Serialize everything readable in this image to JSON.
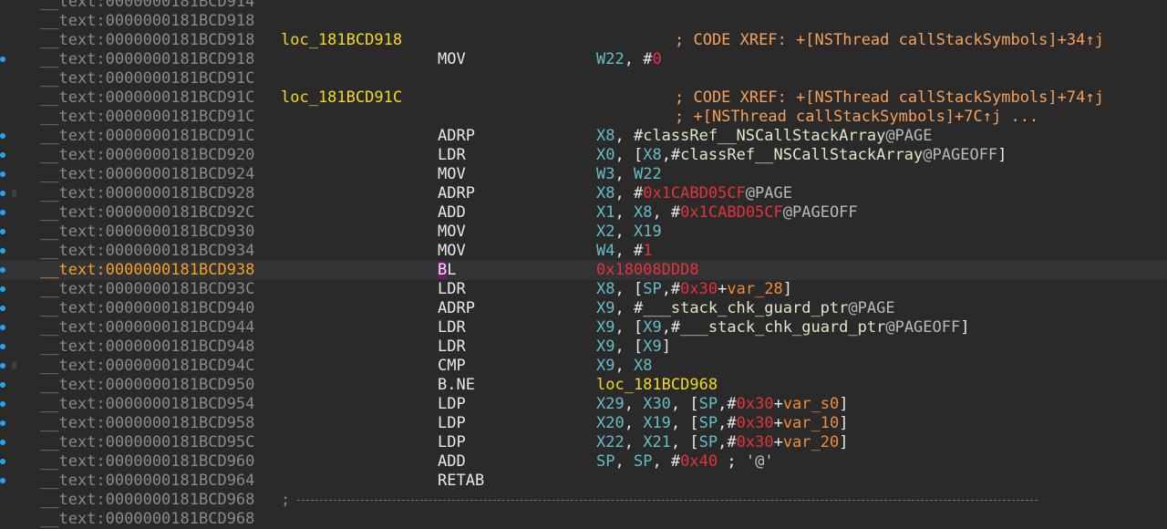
{
  "rows": [
    {
      "addr": "__text:0000000181BCD914",
      "label": "",
      "mnemonic": "",
      "operands": [],
      "comment": "",
      "gutter": "",
      "current": false,
      "separator": false
    },
    {
      "addr": "__text:0000000181BCD918",
      "label": "",
      "mnemonic": "",
      "operands": [],
      "comment": "",
      "gutter": "",
      "current": false,
      "separator": false
    },
    {
      "addr": "__text:0000000181BCD918",
      "label": "loc_181BCD918",
      "mnemonic": "",
      "operands": [],
      "comment": "; CODE XREF: +[NSThread callStackSymbols]+34↑j",
      "gutter": "",
      "current": false,
      "separator": false
    },
    {
      "addr": "__text:0000000181BCD918",
      "label": "",
      "mnemonic": "MOV",
      "operands": [
        [
          "W22",
          "reg"
        ],
        [
          ", #",
          "pun"
        ],
        [
          "0",
          "num"
        ]
      ],
      "comment": "",
      "gutter": "dot",
      "current": false,
      "separator": false
    },
    {
      "addr": "__text:0000000181BCD91C",
      "label": "",
      "mnemonic": "",
      "operands": [],
      "comment": "",
      "gutter": "",
      "current": false,
      "separator": false
    },
    {
      "addr": "__text:0000000181BCD91C",
      "label": "loc_181BCD91C",
      "mnemonic": "",
      "operands": [],
      "comment": "; CODE XREF: +[NSThread callStackSymbols]+74↑j",
      "gutter": "",
      "current": false,
      "separator": false
    },
    {
      "addr": "__text:0000000181BCD91C",
      "label": "",
      "mnemonic": "",
      "operands": [],
      "comment": "; +[NSThread callStackSymbols]+7C↑j ...",
      "gutter": "",
      "current": false,
      "separator": false
    },
    {
      "addr": "__text:0000000181BCD91C",
      "label": "",
      "mnemonic": "ADRP",
      "operands": [
        [
          "X8",
          "reg"
        ],
        [
          ", #",
          "pun"
        ],
        [
          "classRef__NSCallStackArray",
          "sym"
        ],
        [
          "@PAGE",
          "dim"
        ]
      ],
      "comment": "",
      "gutter": "dot",
      "current": false,
      "separator": false
    },
    {
      "addr": "__text:0000000181BCD920",
      "label": "",
      "mnemonic": "LDR",
      "operands": [
        [
          "X0",
          "reg"
        ],
        [
          ", [",
          "pun"
        ],
        [
          "X8",
          "reg"
        ],
        [
          ",#",
          "pun"
        ],
        [
          "classRef__NSCallStackArray",
          "sym"
        ],
        [
          "@PAGEOFF",
          "dim"
        ],
        [
          "]",
          "pun"
        ]
      ],
      "comment": "",
      "gutter": "dot",
      "current": false,
      "separator": false
    },
    {
      "addr": "__text:0000000181BCD924",
      "label": "",
      "mnemonic": "MOV",
      "operands": [
        [
          "W3",
          "reg"
        ],
        [
          ", ",
          "pun"
        ],
        [
          "W22",
          "reg"
        ]
      ],
      "comment": "",
      "gutter": "dot",
      "current": false,
      "separator": false
    },
    {
      "addr": "__text:0000000181BCD928",
      "label": "",
      "mnemonic": "ADRP",
      "operands": [
        [
          "X8",
          "reg"
        ],
        [
          ", #",
          "pun"
        ],
        [
          "0x1CABD05CF",
          "num"
        ],
        [
          "@PAGE",
          "dim"
        ]
      ],
      "comment": "",
      "gutter": "dot",
      "current": false,
      "separator": false
    },
    {
      "addr": "__text:0000000181BCD92C",
      "label": "",
      "mnemonic": "ADD",
      "operands": [
        [
          "X1",
          "reg"
        ],
        [
          ", ",
          "pun"
        ],
        [
          "X8",
          "reg"
        ],
        [
          ", #",
          "pun"
        ],
        [
          "0x1CABD05CF",
          "num"
        ],
        [
          "@PAGEOFF",
          "dim"
        ]
      ],
      "comment": "",
      "gutter": "dot",
      "current": false,
      "separator": false
    },
    {
      "addr": "__text:0000000181BCD930",
      "label": "",
      "mnemonic": "MOV",
      "operands": [
        [
          "X2",
          "reg"
        ],
        [
          ", ",
          "pun"
        ],
        [
          "X19",
          "reg"
        ]
      ],
      "comment": "",
      "gutter": "dot",
      "current": false,
      "separator": false
    },
    {
      "addr": "__text:0000000181BCD934",
      "label": "",
      "mnemonic": "MOV",
      "operands": [
        [
          "W4",
          "reg"
        ],
        [
          ", #",
          "pun"
        ],
        [
          "1",
          "num"
        ]
      ],
      "comment": "",
      "gutter": "dot",
      "current": false,
      "separator": false
    },
    {
      "addr": "__text:0000000181BCD938",
      "label": "",
      "mnemonic": "BL",
      "operands": [
        [
          "0x18008DDD8",
          "call"
        ]
      ],
      "comment": "",
      "gutter": "dot",
      "current": true,
      "separator": false
    },
    {
      "addr": "__text:0000000181BCD93C",
      "label": "",
      "mnemonic": "LDR",
      "operands": [
        [
          "X8",
          "reg"
        ],
        [
          ", [",
          "pun"
        ],
        [
          "SP",
          "reg"
        ],
        [
          ",#",
          "pun"
        ],
        [
          "0x30",
          "num"
        ],
        [
          "+",
          "pun"
        ],
        [
          "var_28",
          "off"
        ],
        [
          "]",
          "pun"
        ]
      ],
      "comment": "",
      "gutter": "dot",
      "current": false,
      "separator": false
    },
    {
      "addr": "__text:0000000181BCD940",
      "label": "",
      "mnemonic": "ADRP",
      "operands": [
        [
          "X9",
          "reg"
        ],
        [
          ", #",
          "pun"
        ],
        [
          "___stack_chk_guard_ptr",
          "sym"
        ],
        [
          "@PAGE",
          "dim"
        ]
      ],
      "comment": "",
      "gutter": "dot",
      "current": false,
      "separator": false
    },
    {
      "addr": "__text:0000000181BCD944",
      "label": "",
      "mnemonic": "LDR",
      "operands": [
        [
          "X9",
          "reg"
        ],
        [
          ", [",
          "pun"
        ],
        [
          "X9",
          "reg"
        ],
        [
          ",#",
          "pun"
        ],
        [
          "___stack_chk_guard_ptr",
          "sym"
        ],
        [
          "@PAGEOFF",
          "dim"
        ],
        [
          "]",
          "pun"
        ]
      ],
      "comment": "",
      "gutter": "dot",
      "current": false,
      "separator": false
    },
    {
      "addr": "__text:0000000181BCD948",
      "label": "",
      "mnemonic": "LDR",
      "operands": [
        [
          "X9",
          "reg"
        ],
        [
          ", [",
          "pun"
        ],
        [
          "X9",
          "reg"
        ],
        [
          "]",
          "pun"
        ]
      ],
      "comment": "",
      "gutter": "dot",
      "current": false,
      "separator": false
    },
    {
      "addr": "__text:0000000181BCD94C",
      "label": "",
      "mnemonic": "CMP",
      "operands": [
        [
          "X9",
          "reg"
        ],
        [
          ", ",
          "pun"
        ],
        [
          "X8",
          "reg"
        ]
      ],
      "comment": "",
      "gutter": "dot",
      "current": false,
      "separator": false
    },
    {
      "addr": "__text:0000000181BCD950",
      "label": "",
      "mnemonic": "B.NE",
      "operands": [
        [
          "loc_181BCD968",
          "loc"
        ]
      ],
      "comment": "",
      "gutter": "dot",
      "current": false,
      "separator": false
    },
    {
      "addr": "__text:0000000181BCD954",
      "label": "",
      "mnemonic": "LDP",
      "operands": [
        [
          "X29",
          "reg"
        ],
        [
          ", ",
          "pun"
        ],
        [
          "X30",
          "reg"
        ],
        [
          ", [",
          "pun"
        ],
        [
          "SP",
          "reg"
        ],
        [
          ",#",
          "pun"
        ],
        [
          "0x30",
          "num"
        ],
        [
          "+",
          "pun"
        ],
        [
          "var_s0",
          "off"
        ],
        [
          "]",
          "pun"
        ]
      ],
      "comment": "",
      "gutter": "dot",
      "current": false,
      "separator": false
    },
    {
      "addr": "__text:0000000181BCD958",
      "label": "",
      "mnemonic": "LDP",
      "operands": [
        [
          "X20",
          "reg"
        ],
        [
          ", ",
          "pun"
        ],
        [
          "X19",
          "reg"
        ],
        [
          ", [",
          "pun"
        ],
        [
          "SP",
          "reg"
        ],
        [
          ",#",
          "pun"
        ],
        [
          "0x30",
          "num"
        ],
        [
          "+",
          "pun"
        ],
        [
          "var_10",
          "off"
        ],
        [
          "]",
          "pun"
        ]
      ],
      "comment": "",
      "gutter": "dot",
      "current": false,
      "separator": false
    },
    {
      "addr": "__text:0000000181BCD95C",
      "label": "",
      "mnemonic": "LDP",
      "operands": [
        [
          "X22",
          "reg"
        ],
        [
          ", ",
          "pun"
        ],
        [
          "X21",
          "reg"
        ],
        [
          ", [",
          "pun"
        ],
        [
          "SP",
          "reg"
        ],
        [
          ",#",
          "pun"
        ],
        [
          "0x30",
          "num"
        ],
        [
          "+",
          "pun"
        ],
        [
          "var_20",
          "off"
        ],
        [
          "]",
          "pun"
        ]
      ],
      "comment": "",
      "gutter": "dot",
      "current": false,
      "separator": false
    },
    {
      "addr": "__text:0000000181BCD960",
      "label": "",
      "mnemonic": "ADD",
      "operands": [
        [
          "SP",
          "reg"
        ],
        [
          ", ",
          "pun"
        ],
        [
          "SP",
          "reg"
        ],
        [
          ", #",
          "pun"
        ],
        [
          "0x40",
          "num"
        ],
        [
          " ; ",
          "spc"
        ],
        [
          "'@'",
          "str"
        ]
      ],
      "comment": "",
      "gutter": "dot",
      "current": false,
      "separator": false
    },
    {
      "addr": "__text:0000000181BCD964",
      "label": "",
      "mnemonic": "RETAB",
      "operands": [],
      "comment": "",
      "gutter": "dot",
      "current": false,
      "separator": false
    },
    {
      "addr": "__text:0000000181BCD968",
      "label": "",
      "mnemonic": "",
      "operands": [],
      "comment": "",
      "gutter": "",
      "current": false,
      "separator": true
    },
    {
      "addr": "__text:0000000181BCD968",
      "label": "",
      "mnemonic": "",
      "operands": [],
      "comment": "",
      "gutter": "",
      "current": false,
      "separator": false
    }
  ],
  "separator_prefix": ";",
  "colors": {
    "background": "#2a2a2a",
    "address": "#8a8a8a",
    "current_address": "#f3a11f",
    "label": "#f2d91f",
    "register": "#64bec8",
    "immediate": "#e4323a",
    "offset": "#f08c3c",
    "comment": "#f6a05a",
    "gutter_dot": "#29a3ee",
    "cursor": "#6b1b6d"
  }
}
